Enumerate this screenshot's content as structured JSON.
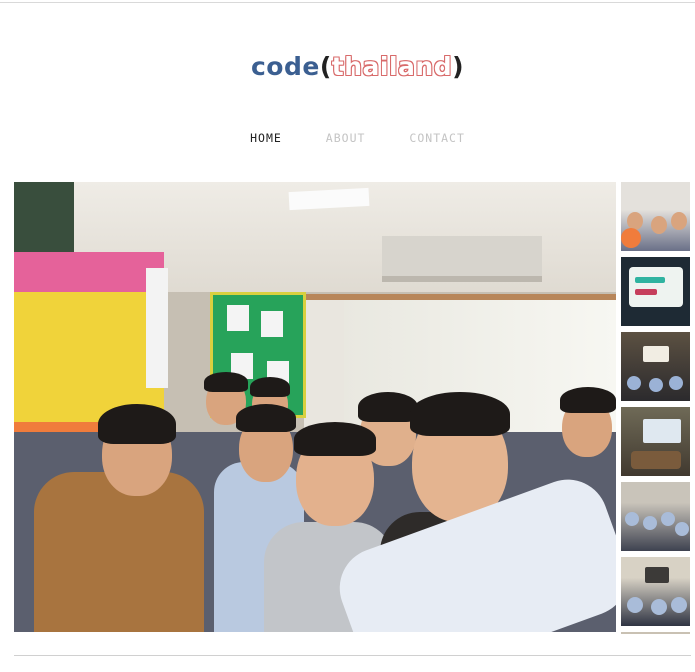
{
  "site": {
    "logo": {
      "code": "code",
      "open_paren": "(",
      "thailand": "thailand",
      "close_paren": ")"
    },
    "nav": {
      "items": [
        "HOME",
        "ABOUT",
        "CONTACT"
      ],
      "active": "HOME"
    }
  },
  "gallery": {
    "main_photo": {
      "icon": "photo-classroom-children"
    },
    "thumbnails": [
      {
        "icon": "thumb-children-group"
      },
      {
        "icon": "thumb-projector-screen"
      },
      {
        "icon": "thumb-classroom-presentation"
      },
      {
        "icon": "thumb-computer-monitor"
      },
      {
        "icon": "thumb-seated-audience"
      },
      {
        "icon": "thumb-classroom-front"
      },
      {
        "icon": "thumb-partial"
      }
    ]
  },
  "colors": {
    "brand_blue": "#3b5f91",
    "brand_red": "#d86a6a",
    "nav_active": "#222222",
    "nav_inactive": "#c4c4c4"
  }
}
